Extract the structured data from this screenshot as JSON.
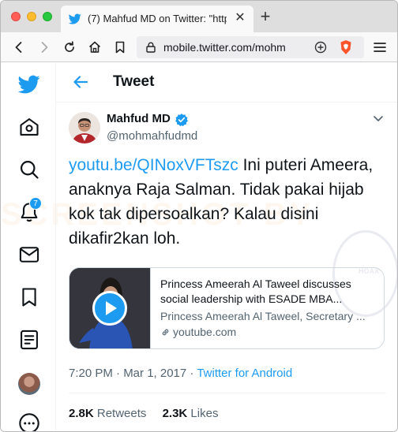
{
  "browser": {
    "tab_title": "(7) Mahfud MD on Twitter: \"https:/",
    "url": "mobile.twitter.com/mohm",
    "new_tab_symbol": "+",
    "close_symbol": "✕"
  },
  "sidebar": {
    "icons": [
      "twitter-logo-icon",
      "home-icon",
      "search-icon",
      "notifications-icon",
      "messages-icon",
      "bookmarks-icon",
      "lists-icon",
      "profile-avatar",
      "more-icon"
    ],
    "notification_count": "7"
  },
  "header": {
    "title": "Tweet"
  },
  "tweet": {
    "author_name": "Mahfud MD",
    "author_handle": "@mohmahfudmd",
    "link_text": "youtu.be/QINoxVFTszc",
    "body": " Ini puteri Ameera, anaknya Raja Salman. Tidak pakai hijab kok tak dipersoalkan? Kalau disini dikafir2kan loh.",
    "time": "7:20 PM · Mar 1, 2017 · ",
    "source": "Twitter for Android",
    "retweets_count": "2.8K",
    "retweets_label": "Retweets",
    "likes_count": "2.3K",
    "likes_label": "Likes"
  },
  "card": {
    "title": "Princess Ameerah Al Taweel discusses social leadership with ESADE MBA...",
    "description": "Princess Ameerah Al Taweel, Secretary ...",
    "domain": "youtube.com"
  },
  "colors": {
    "accent": "#1d9bf0",
    "text": "#0f1419",
    "secondary": "#536471"
  }
}
